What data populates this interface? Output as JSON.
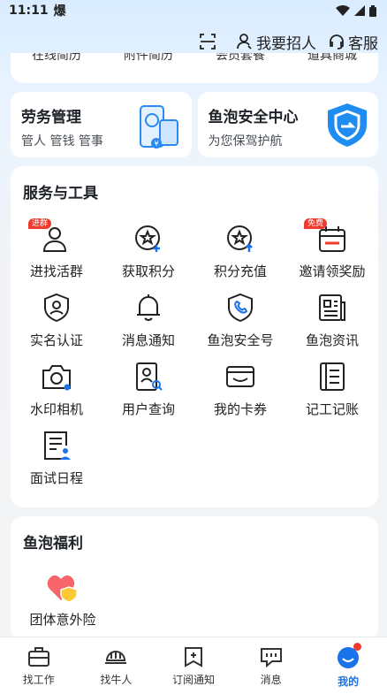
{
  "status": {
    "time": "11:11",
    "extra_glyph": "爆"
  },
  "top_actions": {
    "recruit": "我要招人",
    "service": "客服"
  },
  "clipped_row": [
    "在线简历",
    "附件简历",
    "会员套餐",
    "道具商城"
  ],
  "promo": [
    {
      "title": "劳务管理",
      "subtitle": "管人 管钱 管事"
    },
    {
      "title": "鱼泡安全中心",
      "subtitle": "为您保驾护航"
    }
  ],
  "tools": {
    "title": "服务与工具",
    "items": [
      {
        "label": "进找活群",
        "icon": "group-user-icon",
        "badge": "进群"
      },
      {
        "label": "获取积分",
        "icon": "star-plus-icon",
        "badge": ""
      },
      {
        "label": "积分充值",
        "icon": "star-up-icon",
        "badge": ""
      },
      {
        "label": "邀请领奖励",
        "icon": "gift-calendar-icon",
        "badge": "免费"
      },
      {
        "label": "实名认证",
        "icon": "shield-user-icon",
        "badge": ""
      },
      {
        "label": "消息通知",
        "icon": "bell-icon",
        "badge": ""
      },
      {
        "label": "鱼泡安全号",
        "icon": "shield-phone-icon",
        "badge": ""
      },
      {
        "label": "鱼泡资讯",
        "icon": "news-icon",
        "badge": ""
      },
      {
        "label": "水印相机",
        "icon": "camera-icon",
        "badge": ""
      },
      {
        "label": "用户查询",
        "icon": "user-search-icon",
        "badge": ""
      },
      {
        "label": "我的卡券",
        "icon": "card-icon",
        "badge": ""
      },
      {
        "label": "记工记账",
        "icon": "ledger-icon",
        "badge": ""
      },
      {
        "label": "面试日程",
        "icon": "schedule-icon",
        "badge": ""
      }
    ]
  },
  "welfare": {
    "title": "鱼泡福利",
    "items": [
      {
        "label": "团体意外险",
        "icon": "heart-shield-icon"
      }
    ]
  },
  "tabbar": [
    {
      "label": "找工作",
      "icon": "briefcase-icon",
      "active": false
    },
    {
      "label": "找牛人",
      "icon": "helmet-icon",
      "active": false
    },
    {
      "label": "订阅通知",
      "icon": "subscribe-icon",
      "active": false
    },
    {
      "label": "消息",
      "icon": "chat-icon",
      "active": false
    },
    {
      "label": "我的",
      "icon": "profile-icon",
      "active": true
    }
  ],
  "colors": {
    "accent": "#1a73e8",
    "badge": "#ef3a2e",
    "shield": "#1e8cf0"
  }
}
